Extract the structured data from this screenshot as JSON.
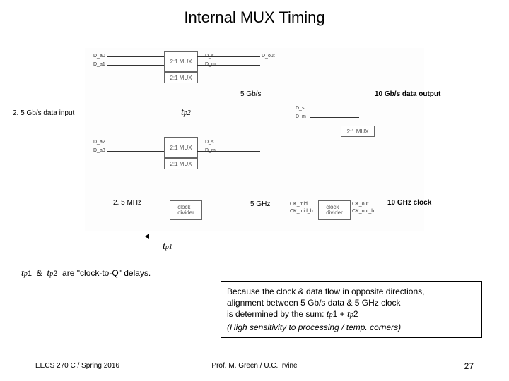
{
  "title": "Internal MUX Timing",
  "labels": {
    "data_in": "2. 5 Gb/s data input",
    "mid_rate": "5 Gb/s",
    "data_out": "10 Gb/s data output",
    "clk_in": "2. 5 MHz",
    "clk_mid": "5 GHz",
    "clk_out": "10 GHz clock",
    "tp1": "t",
    "tp1_sub": "p1",
    "tp2": "t",
    "tp2_sub": "p2"
  },
  "diagram": {
    "mux_label": "2:1 MUX",
    "clock_div_label": "clock\ndivider",
    "signals_left_a": [
      "D_a0",
      "D_a1",
      "D_a2",
      "D_a3"
    ],
    "signals_mid": [
      "D_s",
      "D_m"
    ],
    "signals_right": [
      "D_s",
      "D_m"
    ],
    "out": "D_out",
    "ck_mid": [
      "CK_mid",
      "CK_mid_b"
    ],
    "ck_out": [
      "CK_out",
      "CK_out_b"
    ]
  },
  "notes": {
    "delays": "t_p1 & t_p2 are \"clock-to-Q\" delays.",
    "box_line1": "Because the clock & data flow in opposite directions,",
    "box_line2_a": "alignment between 5 Gb/s data & 5 GHz clock",
    "box_line3_a": "is determined by the sum:  ",
    "box_line3_b": "t_p1 + t_p2",
    "box_line4": "(High sensitivity to processing / temp. corners)"
  },
  "footer": {
    "left": "EECS 270 C / Spring 2016",
    "center": "Prof. M. Green / U.C. Irvine",
    "right": "27"
  }
}
